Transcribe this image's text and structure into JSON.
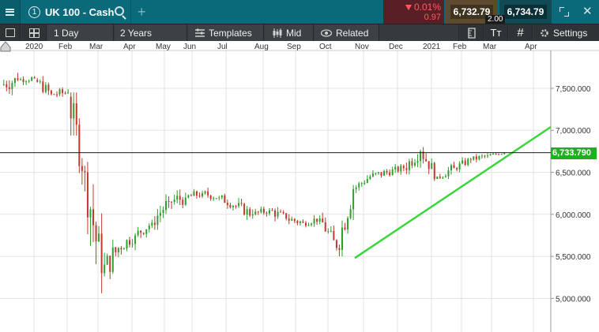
{
  "topbar": {
    "tab_number": "1",
    "tab_title": "UK 100 - Cash",
    "add_tab": "+",
    "change_pct": "0.01%",
    "change_abs": "0.97",
    "sell_price": "6,732.79",
    "buy_price": "6,734.79",
    "spread": "2.00"
  },
  "toolbar": {
    "interval": "1 Day",
    "range": "2 Years",
    "templates": "Templates",
    "price_type": "Mid",
    "related": "Related",
    "settings": "Settings",
    "text_tool": "Tт"
  },
  "colors": {
    "teal": "#0b6a7a",
    "up_candle": "#2e9e2e",
    "down_candle": "#c0392b",
    "trendline": "#3ad73a",
    "price_tag": "#1db11d"
  },
  "chart_data": {
    "type": "candlestick",
    "instrument": "UK 100 - Cash",
    "x_tick_labels": [
      "2020",
      "Feb",
      "Mar",
      "Apr",
      "May",
      "Jun",
      "Jul",
      "Aug",
      "Sep",
      "Oct",
      "Nov",
      "Dec",
      "2021",
      "Feb",
      "Mar",
      "Apr"
    ],
    "y_tick_labels": [
      "7,500.000",
      "7,000.000",
      "6,500.000",
      "6,000.000",
      "5,500.000",
      "5,000.000"
    ],
    "y_ticks": [
      7500,
      7000,
      6500,
      6000,
      5500,
      5000
    ],
    "ylim": [
      4600,
      7950
    ],
    "current_price": 6733.79,
    "current_price_label": "6,733.790",
    "series": [
      {
        "period": "2020-01",
        "open": 7540,
        "high": 7690,
        "low": 7150,
        "close": 7600
      },
      {
        "period": "2020-01b",
        "open": 7600,
        "high": 7690,
        "low": 7480,
        "close": 7620
      },
      {
        "period": "2020-02",
        "open": 7600,
        "high": 7650,
        "low": 7250,
        "close": 7430
      },
      {
        "period": "2020-02b",
        "open": 7430,
        "high": 7600,
        "low": 7300,
        "close": 7450
      },
      {
        "period": "2020-03",
        "open": 7400,
        "high": 7450,
        "low": 6100,
        "close": 6500
      },
      {
        "period": "2020-03b",
        "open": 6500,
        "high": 6800,
        "low": 4850,
        "close": 5300
      },
      {
        "period": "2020-04",
        "open": 5300,
        "high": 5700,
        "low": 4780,
        "close": 5600
      },
      {
        "period": "2020-04b",
        "open": 5600,
        "high": 5950,
        "low": 5500,
        "close": 5750
      },
      {
        "period": "2020-05",
        "open": 5750,
        "high": 6050,
        "low": 5650,
        "close": 5900
      },
      {
        "period": "2020-05b",
        "open": 5900,
        "high": 6250,
        "low": 5750,
        "close": 6150
      },
      {
        "period": "2020-06",
        "open": 6150,
        "high": 6500,
        "low": 6000,
        "close": 6200
      },
      {
        "period": "2020-06b",
        "open": 6200,
        "high": 6350,
        "low": 6050,
        "close": 6250
      },
      {
        "period": "2020-07",
        "open": 6250,
        "high": 6330,
        "low": 6050,
        "close": 6200
      },
      {
        "period": "2020-07b",
        "open": 6200,
        "high": 6300,
        "low": 6000,
        "close": 6100
      },
      {
        "period": "2020-08",
        "open": 6100,
        "high": 6270,
        "low": 5900,
        "close": 6000
      },
      {
        "period": "2020-08b",
        "open": 6000,
        "high": 6200,
        "low": 5950,
        "close": 6050
      },
      {
        "period": "2020-09",
        "open": 6050,
        "high": 6150,
        "low": 5800,
        "close": 5950
      },
      {
        "period": "2020-09b",
        "open": 5950,
        "high": 6100,
        "low": 5800,
        "close": 5900
      },
      {
        "period": "2020-10",
        "open": 5900,
        "high": 6050,
        "low": 5800,
        "close": 5950
      },
      {
        "period": "2020-10b",
        "open": 5950,
        "high": 6020,
        "low": 5480,
        "close": 5600
      },
      {
        "period": "2020-11",
        "open": 5600,
        "high": 6400,
        "low": 5500,
        "close": 6300
      },
      {
        "period": "2020-11b",
        "open": 6300,
        "high": 6550,
        "low": 6250,
        "close": 6450
      },
      {
        "period": "2020-12",
        "open": 6450,
        "high": 6600,
        "low": 6300,
        "close": 6500
      },
      {
        "period": "2020-12b",
        "open": 6500,
        "high": 6600,
        "low": 6350,
        "close": 6550
      },
      {
        "period": "2021-01",
        "open": 6550,
        "high": 6930,
        "low": 6450,
        "close": 6750
      },
      {
        "period": "2021-01b",
        "open": 6750,
        "high": 6800,
        "low": 6330,
        "close": 6450
      },
      {
        "period": "2021-02",
        "open": 6450,
        "high": 6750,
        "low": 6420,
        "close": 6550
      },
      {
        "period": "2021-02b",
        "open": 6550,
        "high": 6750,
        "low": 6500,
        "close": 6650
      },
      {
        "period": "2021-03",
        "open": 6650,
        "high": 6780,
        "low": 6580,
        "close": 6700
      },
      {
        "period": "2021-03b",
        "open": 6700,
        "high": 6780,
        "low": 6680,
        "close": 6734
      }
    ],
    "annotations": [
      {
        "type": "trendline",
        "from": {
          "x": "2020-11",
          "y": 5480
        },
        "to": {
          "x": "2021-04",
          "y": 7040
        }
      },
      {
        "type": "horizontal_line",
        "y": 6733.79
      }
    ]
  }
}
